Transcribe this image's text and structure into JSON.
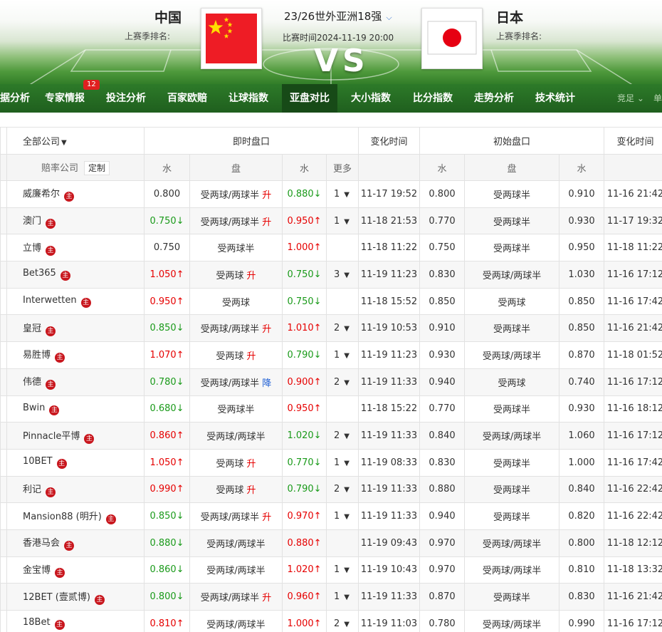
{
  "header": {
    "home_team": "中国",
    "away_team": "日本",
    "home_rank_label": "上赛季排名:",
    "away_rank_label": "上赛季排名:",
    "league": "23/26世外亚洲18强",
    "match_time": "比赛时间2024-11-19 20:00",
    "vs": "VS"
  },
  "nav": {
    "items": [
      "据分析",
      "专家情报",
      "投注分析",
      "百家欧赔",
      "让球指数",
      "亚盘对比",
      "大小指数",
      "比分指数",
      "走势分析",
      "技术统计"
    ],
    "active_index": 5,
    "badge_count": "12",
    "right_select": "竞足",
    "right_cut": "单"
  },
  "table": {
    "group_headers": {
      "company": "全部公司",
      "live": "即时盘口",
      "change_time": "变化时间",
      "initial": "初始盘口",
      "change_time2": "变化时间"
    },
    "sub_headers": {
      "company": "赔率公司",
      "custom": "定制",
      "water1": "水",
      "line": "盘",
      "water2": "水",
      "more": "更多",
      "init_water1": "水",
      "init_line": "盘",
      "init_water2": "水"
    },
    "zhu_label": "主",
    "rows": [
      {
        "company": "威廉希尔",
        "w1": "0.800",
        "w1d": "",
        "line": "受两球/两球半",
        "tag": "升",
        "tagd": "up",
        "w2": "0.880",
        "w2d": "down",
        "more": "1",
        "time": "11-17 19:52",
        "iw1": "0.800",
        "iline": "受两球半",
        "iw2": "0.910",
        "itime": "11-16 21:42"
      },
      {
        "company": "澳门",
        "w1": "0.750",
        "w1d": "down",
        "line": "受两球/两球半",
        "tag": "升",
        "tagd": "up",
        "w2": "0.950",
        "w2d": "up",
        "more": "1",
        "time": "11-18 21:53",
        "iw1": "0.770",
        "iline": "受两球半",
        "iw2": "0.930",
        "itime": "11-17 19:32"
      },
      {
        "company": "立博",
        "w1": "0.750",
        "w1d": "",
        "line": "受两球半",
        "tag": "",
        "tagd": "",
        "w2": "1.000",
        "w2d": "up",
        "more": "",
        "time": "11-18 11:22",
        "iw1": "0.750",
        "iline": "受两球半",
        "iw2": "0.950",
        "itime": "11-18 11:22"
      },
      {
        "company": "Bet365",
        "w1": "1.050",
        "w1d": "up",
        "line": "受两球",
        "tag": "升",
        "tagd": "up",
        "w2": "0.750",
        "w2d": "down",
        "more": "3",
        "time": "11-19 11:23",
        "iw1": "0.830",
        "iline": "受两球/两球半",
        "iw2": "1.030",
        "itime": "11-16 17:12"
      },
      {
        "company": "Interwetten",
        "w1": "0.950",
        "w1d": "up",
        "line": "受两球",
        "tag": "",
        "tagd": "",
        "w2": "0.750",
        "w2d": "down",
        "more": "",
        "time": "11-18 15:52",
        "iw1": "0.850",
        "iline": "受两球",
        "iw2": "0.850",
        "itime": "11-16 17:42"
      },
      {
        "company": "皇冠",
        "w1": "0.850",
        "w1d": "down",
        "line": "受两球/两球半",
        "tag": "升",
        "tagd": "up",
        "w2": "1.010",
        "w2d": "up",
        "more": "2",
        "time": "11-19 10:53",
        "iw1": "0.910",
        "iline": "受两球半",
        "iw2": "0.850",
        "itime": "11-16 21:42"
      },
      {
        "company": "易胜博",
        "w1": "1.070",
        "w1d": "up",
        "line": "受两球",
        "tag": "升",
        "tagd": "up",
        "w2": "0.790",
        "w2d": "down",
        "more": "1",
        "time": "11-19 11:23",
        "iw1": "0.930",
        "iline": "受两球/两球半",
        "iw2": "0.870",
        "itime": "11-18 01:52"
      },
      {
        "company": "伟德",
        "w1": "0.780",
        "w1d": "down",
        "line": "受两球/两球半",
        "tag": "降",
        "tagd": "down",
        "w2": "0.900",
        "w2d": "up",
        "more": "2",
        "time": "11-19 11:33",
        "iw1": "0.940",
        "iline": "受两球",
        "iw2": "0.740",
        "itime": "11-16 17:12"
      },
      {
        "company": "Bwin",
        "w1": "0.680",
        "w1d": "down",
        "line": "受两球半",
        "tag": "",
        "tagd": "",
        "w2": "0.950",
        "w2d": "up",
        "more": "",
        "time": "11-18 15:22",
        "iw1": "0.770",
        "iline": "受两球半",
        "iw2": "0.930",
        "itime": "11-16 18:12"
      },
      {
        "company": "Pinnacle平博",
        "w1": "0.860",
        "w1d": "up",
        "line": "受两球/两球半",
        "tag": "",
        "tagd": "",
        "w2": "1.020",
        "w2d": "down",
        "more": "2",
        "time": "11-19 11:33",
        "iw1": "0.840",
        "iline": "受两球/两球半",
        "iw2": "1.060",
        "itime": "11-16 17:12"
      },
      {
        "company": "10BET",
        "w1": "1.050",
        "w1d": "up",
        "line": "受两球",
        "tag": "升",
        "tagd": "up",
        "w2": "0.770",
        "w2d": "down",
        "more": "1",
        "time": "11-19 08:33",
        "iw1": "0.830",
        "iline": "受两球半",
        "iw2": "1.000",
        "itime": "11-16 17:42"
      },
      {
        "company": "利记",
        "w1": "0.990",
        "w1d": "up",
        "line": "受两球",
        "tag": "升",
        "tagd": "up",
        "w2": "0.790",
        "w2d": "down",
        "more": "2",
        "time": "11-19 11:33",
        "iw1": "0.880",
        "iline": "受两球半",
        "iw2": "0.840",
        "itime": "11-16 22:42"
      },
      {
        "company": "Mansion88 (明升)",
        "w1": "0.850",
        "w1d": "down",
        "line": "受两球/两球半",
        "tag": "升",
        "tagd": "up",
        "w2": "0.970",
        "w2d": "up",
        "more": "1",
        "time": "11-19 11:33",
        "iw1": "0.940",
        "iline": "受两球半",
        "iw2": "0.820",
        "itime": "11-16 22:42"
      },
      {
        "company": "香港马会",
        "w1": "0.880",
        "w1d": "down",
        "line": "受两球/两球半",
        "tag": "",
        "tagd": "",
        "w2": "0.880",
        "w2d": "up",
        "more": "",
        "time": "11-19 09:43",
        "iw1": "0.970",
        "iline": "受两球/两球半",
        "iw2": "0.800",
        "itime": "11-18 12:12"
      },
      {
        "company": "金宝博",
        "w1": "0.860",
        "w1d": "down",
        "line": "受两球/两球半",
        "tag": "",
        "tagd": "",
        "w2": "1.020",
        "w2d": "up",
        "more": "1",
        "time": "11-19 10:43",
        "iw1": "0.970",
        "iline": "受两球/两球半",
        "iw2": "0.810",
        "itime": "11-18 13:32"
      },
      {
        "company": "12BET (壹贰博)",
        "w1": "0.800",
        "w1d": "down",
        "line": "受两球/两球半",
        "tag": "升",
        "tagd": "up",
        "w2": "0.960",
        "w2d": "up",
        "more": "1",
        "time": "11-19 11:33",
        "iw1": "0.870",
        "iline": "受两球半",
        "iw2": "0.830",
        "itime": "11-16 21:42"
      },
      {
        "company": "18Bet",
        "w1": "0.810",
        "w1d": "up",
        "line": "受两球/两球半",
        "tag": "",
        "tagd": "",
        "w2": "1.000",
        "w2d": "up",
        "more": "2",
        "time": "11-19 11:03",
        "iw1": "0.780",
        "iline": "受两球/两球半",
        "iw2": "0.990",
        "itime": "11-16 17:12"
      }
    ]
  },
  "colors": {
    "up": "#e60000",
    "down": "#1a9a1a",
    "nav_bg": "#2d7a29",
    "nav_active": "#174a17",
    "badge": "#e02020",
    "zhu_badge": "#c8161d"
  }
}
